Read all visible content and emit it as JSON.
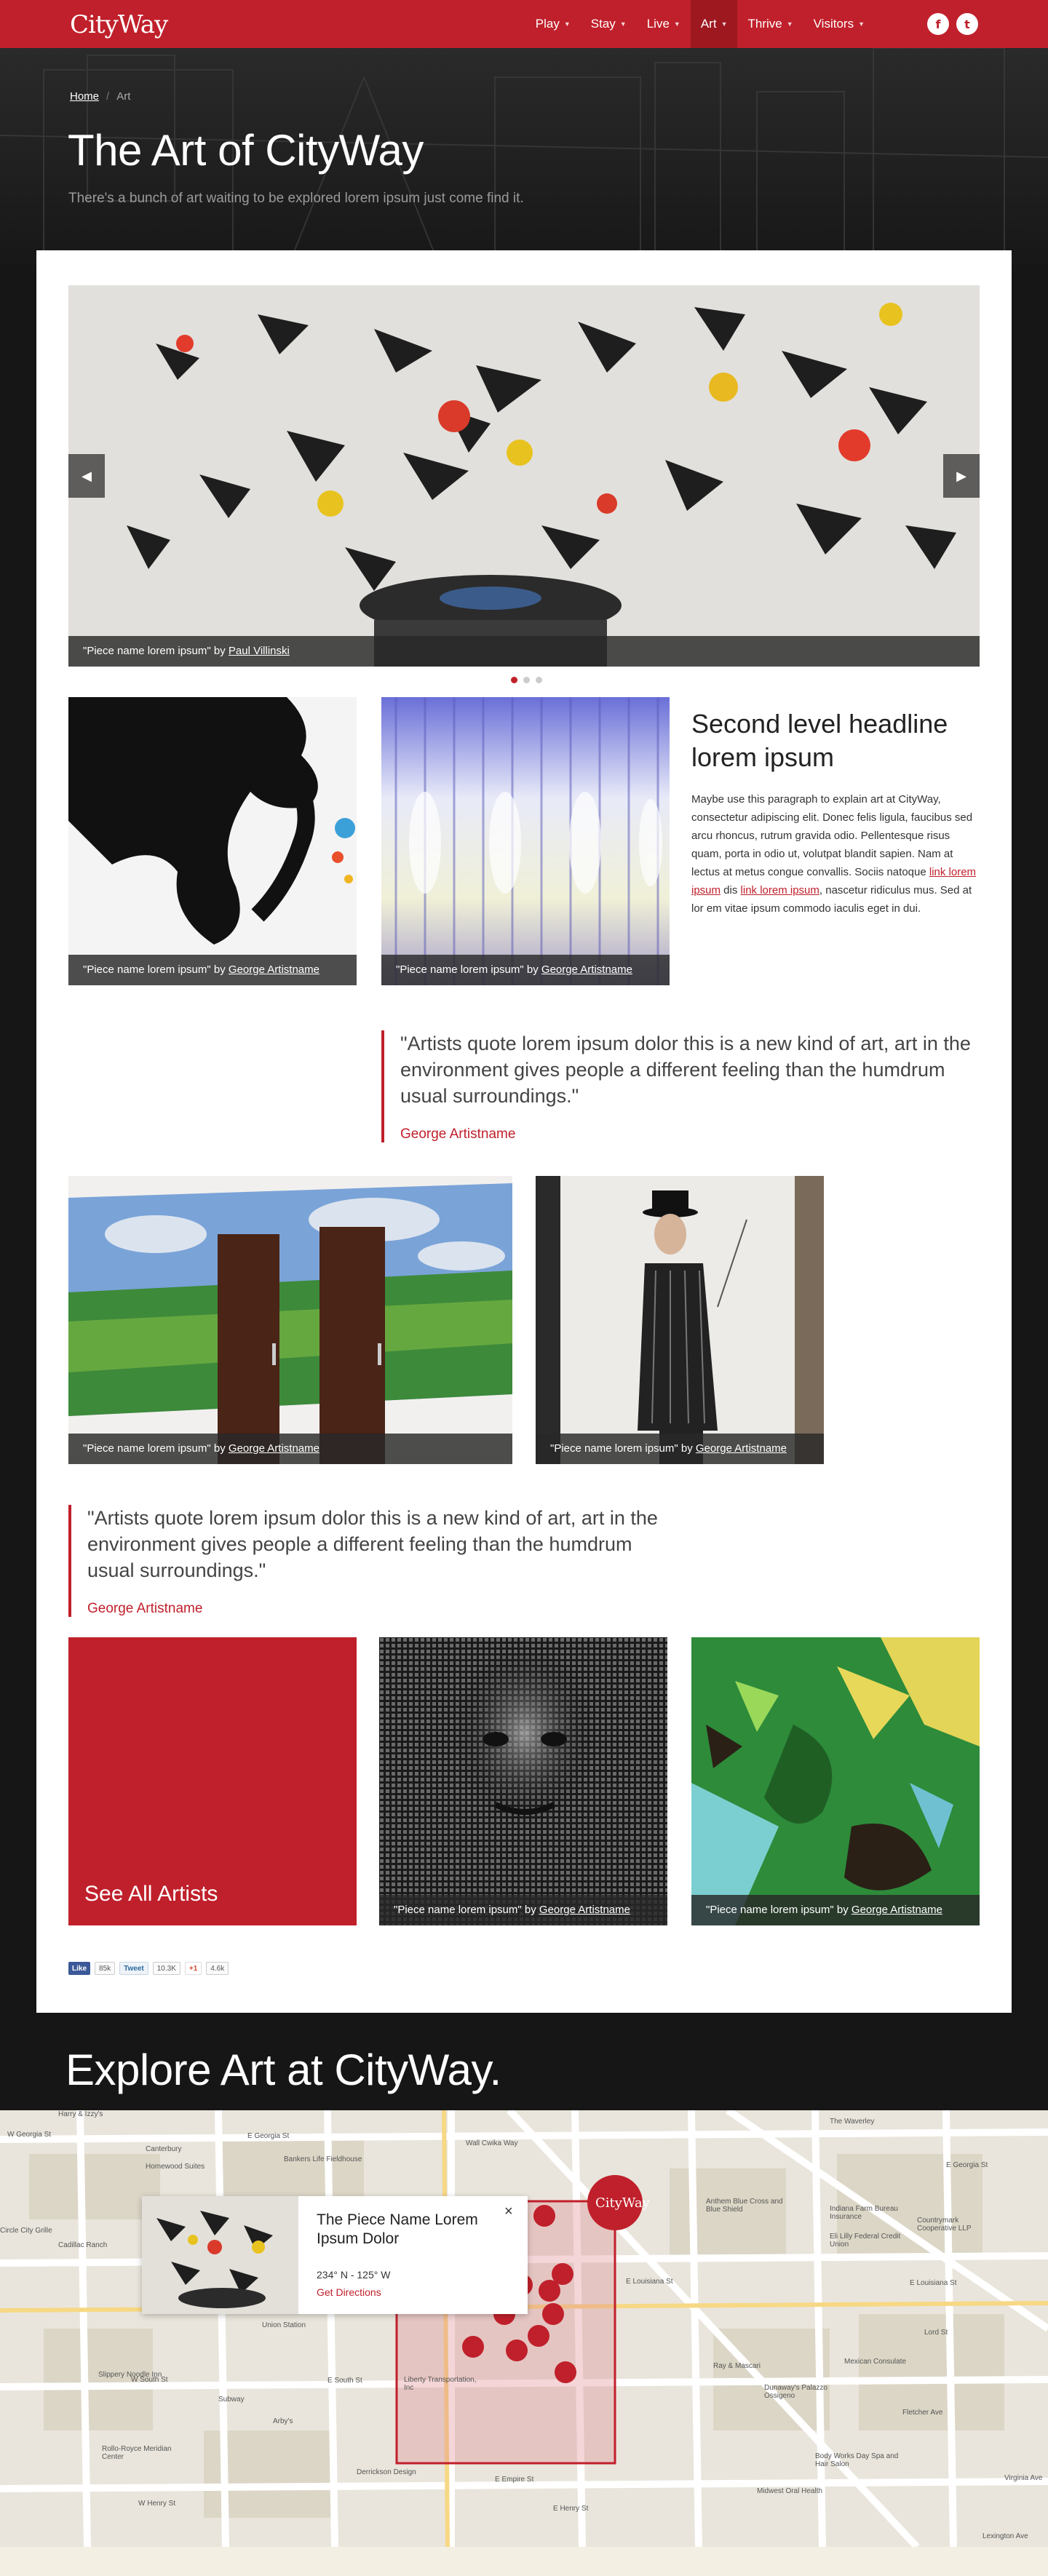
{
  "nav": {
    "logo": "CityWay",
    "items": [
      {
        "label": "Play",
        "caret": "▼"
      },
      {
        "label": "Stay",
        "caret": "▼"
      },
      {
        "label": "Live",
        "caret": "▼"
      },
      {
        "label": "Art",
        "caret": "▼"
      },
      {
        "label": "Thrive",
        "caret": "▼"
      },
      {
        "label": "Visitors",
        "caret": "▼"
      }
    ],
    "social": {
      "facebook": "f",
      "twitter": "t"
    }
  },
  "breadcrumb": {
    "home": "Home",
    "separator": "/",
    "current": "Art"
  },
  "hero": {
    "title": "The Art of CityWay",
    "subtitle": "There's a bunch of art waiting to be explored lorem ipsum just come find it."
  },
  "slider": {
    "caption_piece": "\"Piece name lorem ipsum\" by ",
    "caption_artist": "Paul Villinski",
    "prev": "◀",
    "next": "▶"
  },
  "gallery": {
    "row1": [
      {
        "piece": "\"Piece name lorem ipsum\" by ",
        "artist": "George Artistname"
      },
      {
        "piece": "\"Piece name lorem ipsum\" by ",
        "artist": "George Artistname"
      }
    ],
    "row2": [
      {
        "piece": "\"Piece name lorem ipsum\" by ",
        "artist": "George Artistname"
      },
      {
        "piece": "\"Piece name lorem ipsum\" by ",
        "artist": "George Artistname"
      }
    ],
    "row3": [
      {
        "piece": "\"Piece name lorem ipsum\" by ",
        "artist": "George Artistname"
      },
      {
        "piece": "\"Piece name lorem ipsum\" by ",
        "artist": "George Artistname"
      }
    ]
  },
  "article": {
    "headline": "Second level headline lorem ipsum",
    "para_1": "Maybe use this paragraph to explain art at CityWay, consectetur adipiscing elit. Donec felis ligula, faucibus sed arcu rhoncus, rutrum gravida odio. Pellentesque risus quam, porta in odio ut, volutpat blandit sapien. Nam at lectus at metus congue convallis. Sociis natoque ",
    "link_1": "link lorem ipsum",
    "para_2": " dis ",
    "link_2": "link lorem ipsum",
    "para_3": ", nascetur ridiculus mus. Sed at lor em vitae ipsum commodo iaculis eget in dui."
  },
  "quotes": [
    {
      "text": "\"Artists quote lorem ipsum dolor this is a new kind of art, art in the environment gives people a different feeling than the humdrum usual surroundings.\"",
      "author": "George Artistname"
    },
    {
      "text": "\"Artists quote lorem ipsum dolor this is a new kind of art, art in the environment gives people a different feeling than the humdrum usual surroundings.\"",
      "author": "George Artistname"
    }
  ],
  "see_all": "See All Artists",
  "share": {
    "like": "Like",
    "like_count": "85k",
    "tweet": "Tweet",
    "tweet_count": "10.3K",
    "gplus": "+1",
    "gplus_count": "4.6k"
  },
  "explore_title": "Explore Art at CityWay.",
  "map": {
    "popup": {
      "title": "The Piece Name Lorem Ipsum Dolor",
      "coords": "234° N  -  125° W",
      "directions": "Get Directions",
      "close": "×"
    },
    "badge": "CityWay",
    "labels": [
      "Harry & Izzy's",
      "W Georgia St",
      "Canterbury",
      "Homewood Suites",
      "E Georgia St",
      "Bankers Life Fieldhouse",
      "Wall Cwika Way",
      "Anthem Blue Cross and Blue Shield",
      "Indiana Farm Bureau Insurance",
      "Eli Lilly Federal Credit Union",
      "Countrymark Cooperative LLP",
      "E Georgia St",
      "The Waverley",
      "E Louisiana St",
      "E Louisiana St",
      "Lord St",
      "Ray & Mascari",
      "Mexican Consulate",
      "Slippery Noodle Inn",
      "Subway",
      "Arby's",
      "Union Station",
      "W South St",
      "E South St",
      "Liberty Transportation, Inc",
      "Dunaway's Palazzo Ossigeno",
      "Fletcher Ave",
      "Body Works Day Spa and Hair Salon",
      "Derrickson Design",
      "E Empire St",
      "E Henry St",
      "W Henry St",
      "Midwest Oral Health",
      "Cadillac Ranch",
      "Circle City Grille",
      "Rollo-Royce Meridian Center",
      "Lexington Ave",
      "Virginia Ave"
    ]
  }
}
